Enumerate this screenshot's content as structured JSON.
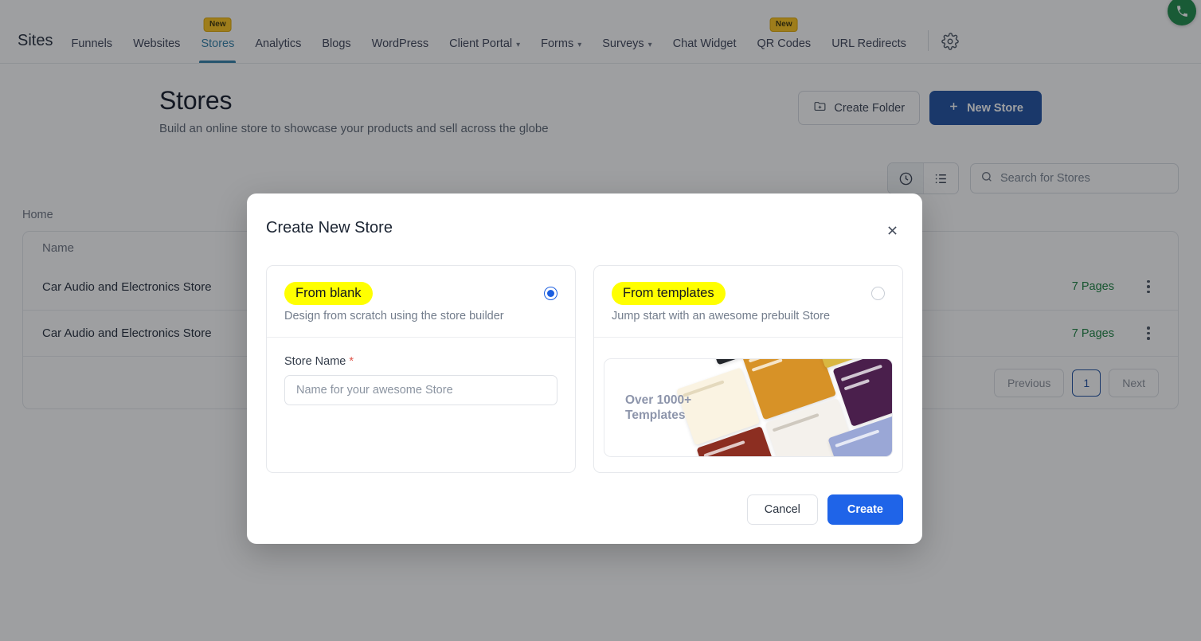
{
  "topnav": {
    "brand": "Sites",
    "items": [
      {
        "label": "Funnels",
        "active": false,
        "caret": false,
        "badge": ""
      },
      {
        "label": "Websites",
        "active": false,
        "caret": false,
        "badge": ""
      },
      {
        "label": "Stores",
        "active": true,
        "caret": false,
        "badge": "New"
      },
      {
        "label": "Analytics",
        "active": false,
        "caret": false,
        "badge": ""
      },
      {
        "label": "Blogs",
        "active": false,
        "caret": false,
        "badge": ""
      },
      {
        "label": "WordPress",
        "active": false,
        "caret": false,
        "badge": ""
      },
      {
        "label": "Client Portal",
        "active": false,
        "caret": true,
        "badge": ""
      },
      {
        "label": "Forms",
        "active": false,
        "caret": true,
        "badge": ""
      },
      {
        "label": "Surveys",
        "active": false,
        "caret": true,
        "badge": ""
      },
      {
        "label": "Chat Widget",
        "active": false,
        "caret": false,
        "badge": ""
      },
      {
        "label": "QR Codes",
        "active": false,
        "caret": false,
        "badge": "New"
      },
      {
        "label": "URL Redirects",
        "active": false,
        "caret": false,
        "badge": ""
      }
    ],
    "settings_icon": "gear-icon",
    "call_icon": "phone-icon",
    "accent_active": "#2f7fa8",
    "badge_color": "#ffc519"
  },
  "header": {
    "title": "Stores",
    "subtitle": "Build an online store to showcase your products and sell across the globe",
    "create_folder_label": "Create Folder",
    "new_store_label": "New Store",
    "primary_color": "#1c4fa1"
  },
  "toolbar": {
    "recent_view_icon": "clock-icon",
    "list_view_icon": "list-icon",
    "search_icon": "search-icon",
    "search_value": "",
    "search_placeholder": "Search for Stores"
  },
  "breadcrumb": {
    "label": "Home"
  },
  "table": {
    "columns": [
      "Name"
    ],
    "rows": [
      {
        "name": "Car Audio and Electronics Store",
        "pages": "7 Pages",
        "menu_icon": "kebab-menu-icon"
      },
      {
        "name": "Car Audio and Electronics Store",
        "pages": "7 Pages",
        "menu_icon": "kebab-menu-icon"
      }
    ],
    "pagination": {
      "previous_label": "Previous",
      "page_number": "1",
      "next_label": "Next"
    }
  },
  "modal": {
    "title": "Create New Store",
    "close_icon": "close-icon",
    "options": [
      {
        "label": "From blank",
        "description": "Design from scratch using the store builder",
        "selected": true,
        "highlight_color": "#ffff00"
      },
      {
        "label": "From templates",
        "description": "Jump start with an awesome prebuilt Store",
        "selected": false,
        "highlight_color": "#ffff00"
      }
    ],
    "store_name": {
      "label": "Store Name",
      "required_mark": "*",
      "value": "",
      "placeholder": "Name for your awesome Store"
    },
    "promo": {
      "text": "Over 1000+\nTemplates",
      "image_name": "templates-collage-image"
    },
    "footer": {
      "cancel_label": "Cancel",
      "create_label": "Create",
      "create_color": "#1f64e8"
    }
  }
}
